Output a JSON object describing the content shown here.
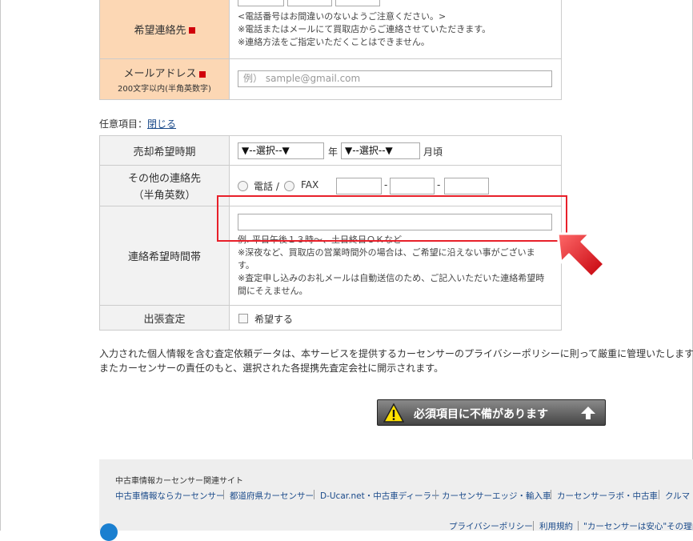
{
  "phone_contact": {
    "label": "希望連絡先",
    "notes": [
      "<電話番号はお間違いのないようご注意ください。>",
      "※電話またはメールにて買取店からご連絡させていただきます。",
      "※連絡方法をご指定いただくことはできません。"
    ]
  },
  "email": {
    "label": "メールアドレス",
    "sublabel": "200文字以内(半角英数字)",
    "placeholder": "例） sample@gmail.com"
  },
  "optional": {
    "label": "任意項目：",
    "close_link": "閉じる"
  },
  "sell_time": {
    "label": "売却希望時期",
    "year_select": "▼--選択--▼",
    "year_unit": "年",
    "month_select": "▼--選択--▼",
    "month_unit": "月頃"
  },
  "other_contact": {
    "label": "その他の連絡先",
    "sublabel": "（半角英数）",
    "phone_option": "電話 /",
    "fax_option": "FAX",
    "dash": "-"
  },
  "contact_time": {
    "label": "連絡希望時間帯",
    "example": "例. 平日午後１３時〜、土日終日ＯＫなど",
    "note1_a": "※深夜など、買取店の営業時間外の場合は、ご希望に沿えない事がございま",
    "note1_b": "す。",
    "note2_a": "※査定申し込みのお礼メールは自動送信のため、ご記入いただいた連絡希望時",
    "note2_b": "間にそえません。"
  },
  "onsite": {
    "label": "出張査定",
    "checkbox_label": "希望する"
  },
  "privacy": {
    "line1": "入力された個人情報を含む査定依頼データは、本サービスを提供するカーセンサーのプライバシーポリシーに則って厳重に管理いたします",
    "line2": "またカーセンサーの責任のもと、選択された各提携先査定会社に開示されます。"
  },
  "submit": {
    "label": "必須項目に不備があります"
  },
  "footer": {
    "heading": "中古車情報カーセンサー関連サイト",
    "links": [
      "中古車情報ならカーセンサー",
      "都道府県カーセンサー",
      "D-Ucar.net・中古車ディーラー",
      "カーセンサーエッジ・輸入車",
      "カーセンサーラボ・中古車",
      "クルマ"
    ],
    "bottom_links": [
      "プライバシーポリシー",
      "利用規約",
      "\"カーセンサーは安心\"その理由"
    ]
  },
  "colors": {
    "required_label_bg": "#fcd7b4",
    "required_mark": "#d0000b",
    "highlight": "#e8202a",
    "link": "#1a4a8a"
  }
}
